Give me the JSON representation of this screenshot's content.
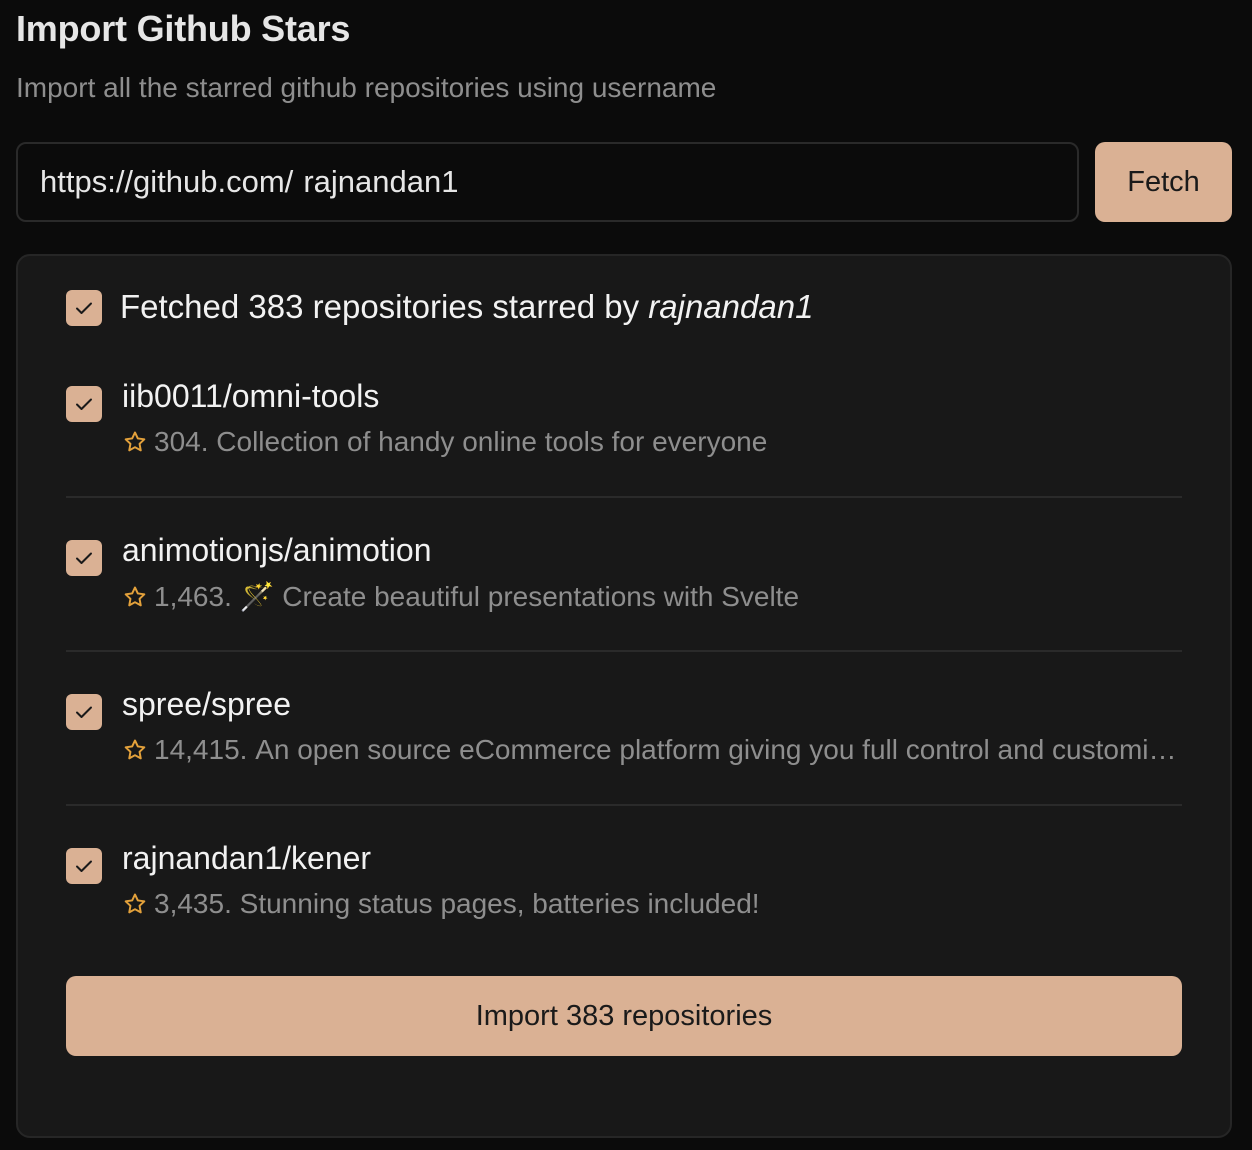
{
  "header": {
    "title": "Import Github Stars",
    "subtitle": "Import all the starred github repositories using username"
  },
  "form": {
    "url_prefix": "https://github.com/",
    "username": "rajnandan1",
    "fetch_label": "Fetch"
  },
  "summary": {
    "prefix": "Fetched 383 repositories starred by ",
    "username": "rajnandan1",
    "checked": true
  },
  "repos": [
    {
      "name": "iib0011/omni-tools",
      "stars": "304.",
      "description": "Collection of handy online tools for everyone",
      "checked": true
    },
    {
      "name": "animotionjs/animotion",
      "stars": "1,463.",
      "description": "🪄 Create beautiful presentations with Svelte",
      "checked": true
    },
    {
      "name": "spree/spree",
      "stars": "14,415.",
      "description": "An open source eCommerce platform giving you full control and customizability",
      "checked": true
    },
    {
      "name": "rajnandan1/kener",
      "stars": "3,435.",
      "description": "Stunning status pages, batteries included!",
      "checked": true
    }
  ],
  "import_label": "Import 383 repositories",
  "icons": {
    "star": "star-outline-icon",
    "check": "check-icon"
  },
  "colors": {
    "accent": "#dab194",
    "star": "#e3a13b",
    "background": "#0b0b0b",
    "panel": "#181818"
  }
}
